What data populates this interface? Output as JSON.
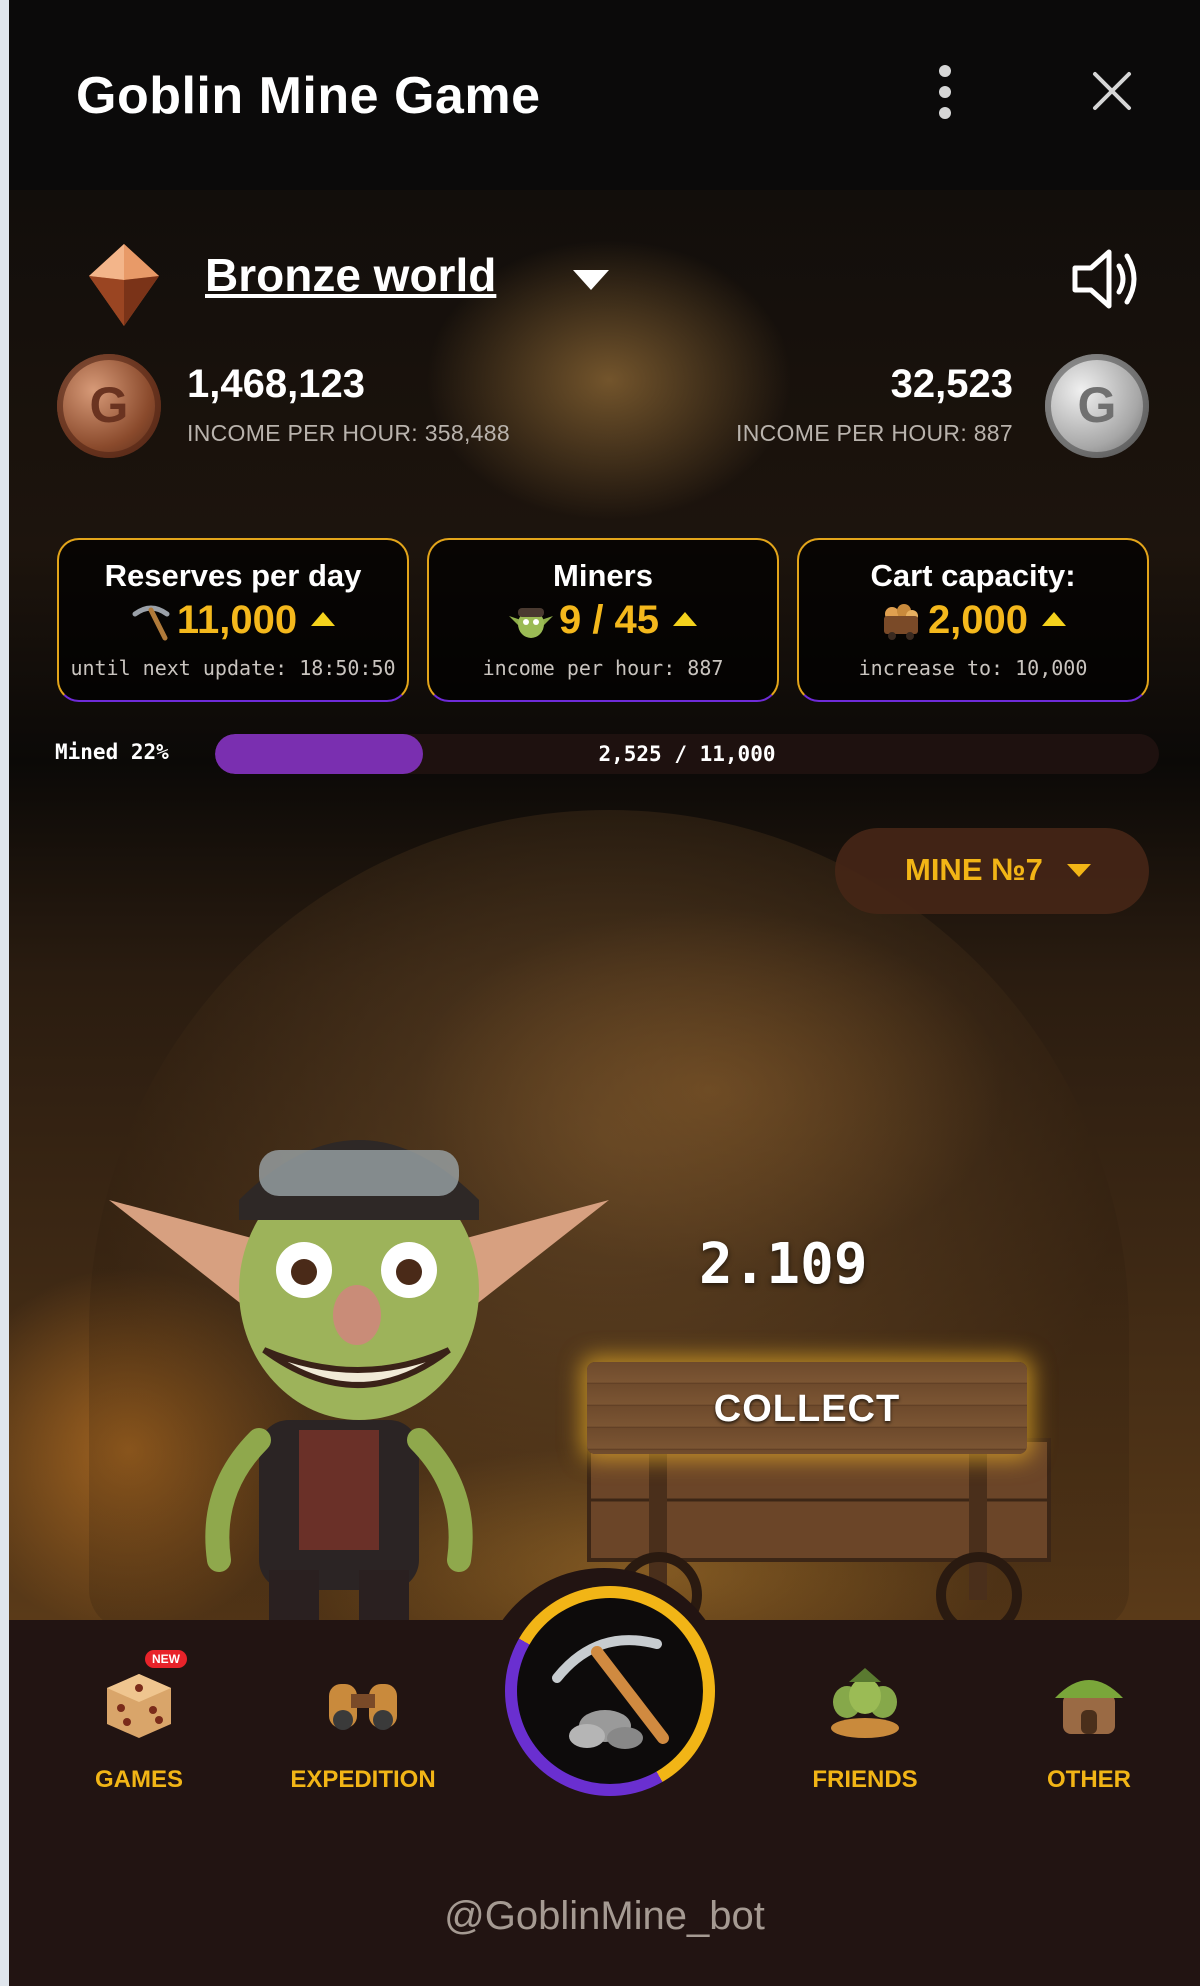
{
  "window": {
    "title": "Goblin Mine Game"
  },
  "world": {
    "name": "Bronze world"
  },
  "balances": {
    "bronze": {
      "amount": "1,468,123",
      "income_label": "INCOME PER HOUR:",
      "income_value": "358,488",
      "coin_letter": "G"
    },
    "silver": {
      "amount": "32,523",
      "income_label": "INCOME PER HOUR:",
      "income_value": "887",
      "coin_letter": "G"
    }
  },
  "cards": [
    {
      "title": "Reserves per day",
      "value": "11,000",
      "sub": "until next update: 18:50:50",
      "icon": "pickaxe-icon"
    },
    {
      "title": "Miners",
      "value": "9 / 45",
      "sub": "income per hour: 887",
      "icon": "goblin-head-icon"
    },
    {
      "title": "Cart capacity:",
      "value": "2,000",
      "sub": "increase to: 10,000",
      "icon": "ore-cart-icon"
    }
  ],
  "progress": {
    "label": "Mined 22%",
    "text": "2,525 / 11,000",
    "fraction": 0.22
  },
  "mine_selector": {
    "label": "MINE №7"
  },
  "cart": {
    "counter": "2.109",
    "collect_label": "COLLECT"
  },
  "nav": {
    "games": {
      "label": "GAMES",
      "badge": "NEW"
    },
    "expedition": {
      "label": "EXPEDITION"
    },
    "friends": {
      "label": "FRIENDS"
    },
    "other": {
      "label": "OTHER"
    }
  },
  "footer": {
    "bot": "@GoblinMine_bot"
  },
  "colors": {
    "accent": "#f2b516",
    "purple": "#6f2bd8",
    "nav_bg": "#221412"
  }
}
